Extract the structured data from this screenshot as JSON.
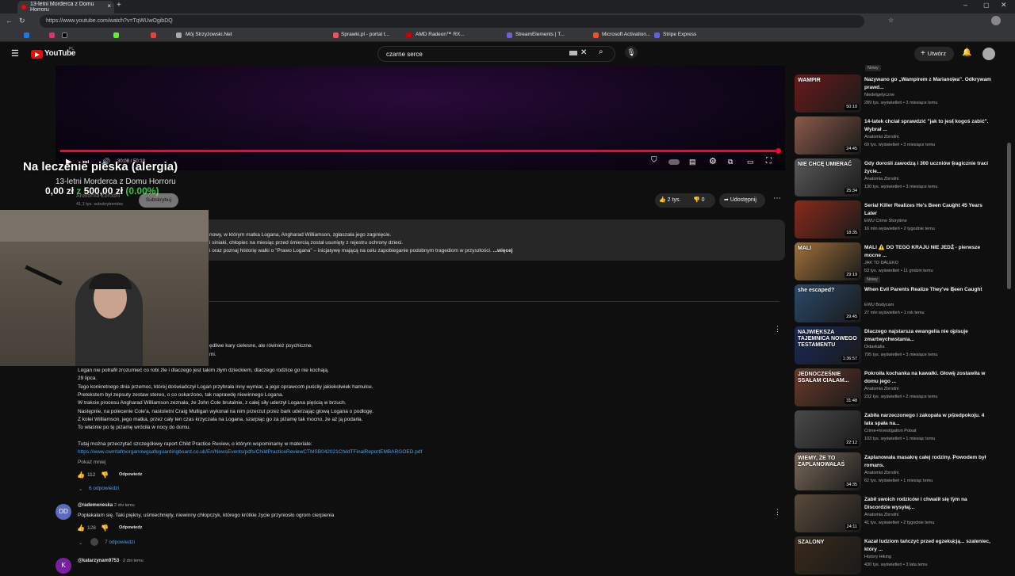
{
  "browser": {
    "tab_title": "13-letni Morderca z Domu Horroru",
    "url": "https://www.youtube.com/watch?v=TqWUwOgibDQ",
    "bookmarks": [
      "Mój Strzyżowski.Net",
      "Sprawki.pl - portal t...",
      "AMD Radeon™ RX...",
      "StreamElements | T...",
      "Microsoft Activation...",
      "Stripe Express"
    ]
  },
  "header": {
    "logo": "YouTube",
    "logo_region": "PL",
    "search_value": "czarne serce",
    "create_label": "Utwórz"
  },
  "player": {
    "time": "30:08 / 50:18",
    "progress": 0.996
  },
  "overlay": {
    "title": "Na leczenie pieska (alergia)",
    "subtitle": "13-letni Morderca z Domu Horroru",
    "money_prefix": "0,00 zł",
    "money_sep": " z ",
    "money_goal": "500,00 zł",
    "money_percent": "(0.00%)"
  },
  "channel": {
    "name": "Anatomia Zbrodni",
    "subscribers": "41,1 tys. subskrybentów",
    "subscribe": "Subskrybuj"
  },
  "actions": {
    "likes": "2 tys.",
    "dislikes": "0",
    "share": "Udostępnij"
  },
  "description": {
    "line1": "nowy, w którym matka Logana, Angharad Williamson, zgłaszała jego zaginięcie.",
    "line2": "i siniaki, chłopiec na miesiąc przed śmiercią został usunięty z rejestru ochrony dzieci.",
    "line3": "i oraz poznaj historię walki o \"Prawo Logana\" – inicjatywę mającą na celu zapobieganie podobnym tragediom w przyszłości.",
    "more": "...więcej"
  },
  "comment1": {
    "partial1": "ędliwe kary cielesne, ale również psychiczne.",
    "partial2": "mi.",
    "lines": [
      "Logan nie potrafił zrozumieć co robi źle i dlaczego jest takim złym dzieckiem, dlaczego rodzice go nie kochają.",
      "29 lipca.",
      "Tego konkretnego dnia przemoc, której doświadczył Logan przybrała inny wymiar, a jego oprawcom puściły jakiekolwiek hamulce.",
      "Pretekstem był zepsuty zestaw stereo, o co oskarżono, tak naprawdę niewinnego Logana.",
      "W trakcie procesu Angharad Williamson zeznała, że John Cole brutalnie, z całej siły uderzył Logana pięścią w brzuch.",
      "Następnie, na polecenie Cole'a, nastoletni Craig Mulligan wykonał na nim przerzut przez bark uderzając głową Logana o podłogę.",
      "Z kolei Williamson, jego matka, przez cały ten czas krzyczała na Logana, szarpiąc go za piżamę tak mocno, że aż ją podarła.",
      "To właśnie po tę piżamę wróciła w nocy do domu."
    ],
    "report_intro": "Tutaj można przeczytać szczegółowy raport Child Practice Review, o którym wspominamy w materiale:",
    "report_link": "https://www.cwmtafmorgannwgsafeguardingboard.co.uk/En/NewsEvents/pdfs/ChildPracticeReviewCTMSB042021ChildTFinalReportEMBARGOED.pdf",
    "show_less": "Pokaż mniej",
    "likes": "112",
    "reply": "Odpowiedz",
    "replies": "6 odpowiedzi"
  },
  "comment2": {
    "avatar": "DD",
    "author": "@rademeneska",
    "time": "2 dni temu",
    "text": "Popłakałam się. Taki piękny, uśmiechnięty, niewinny chłopczyk, którego krótkie życie przyniosło ogrom cierpienia",
    "likes": "128",
    "reply": "Odpowiedz",
    "replies": "7 odpowiedzi"
  },
  "comment3": {
    "avatar": "K",
    "author": "@katarzynam9753",
    "time": "2 dni temu"
  },
  "sidebar": [
    {
      "title": "Nazywano go „Wampirem z Marianowa\". Odkrywam prawd...",
      "channel": "Niedetgetyczne",
      "meta": "289 tys. wyświetleń • 3 miesiące temu",
      "duration": "50:10",
      "thumb_text": "WAMPIR",
      "color": "#6b1a1a"
    },
    {
      "title": "14-latek chciał sprawdzić \"jak to jest kogoś zabić\". Wybrał ...",
      "channel": "Anatomia Zbrodni",
      "meta": "69 tys. wyświetleń • 3 miesiące temu",
      "duration": "24:45",
      "thumb_text": "",
      "color": "#8b5a4a"
    },
    {
      "title": "Gdy dorośli zawodzą i 300 uczniów tragicznie traci życie...",
      "channel": "Anatomia Zbrodni",
      "meta": "130 tys. wyświetleń • 3 miesiące temu",
      "duration": "25:34",
      "thumb_text": "NIE CHCĘ UMIERAĆ",
      "color": "#5a5a5a"
    },
    {
      "title": "Serial Killer Realizes He's Been Caught 45 Years Later",
      "channel": "EWU Crime Storytime",
      "meta": "16 mln wyświetleń • 2 tygodnie temu",
      "duration": "18:35",
      "thumb_text": "",
      "color": "#8a2a1a"
    },
    {
      "title": "MALI ⚠️ DO TEGO KRAJU NIE JEDŹ - pierwsze mocne ...",
      "channel": "JAK TO DALEKO",
      "meta": "53 tys. wyświetleń • 11 godzin temu",
      "duration": "29:19",
      "thumb_text": "MALI",
      "color": "#a0703a",
      "badge": "Nowy"
    },
    {
      "title": "When Evil Parents Realize They've Been Caught",
      "channel": "EWU Bodycam",
      "meta": "27 mln wyświetleń • 1 rok temu",
      "duration": "29:45",
      "thumb_text": "she escaped?",
      "color": "#2a4a6a"
    },
    {
      "title": "Dlaczego najstarsza ewangelia nie opisuje zmartwychwstania...",
      "channel": "Didaskalia",
      "meta": "795 tys. wyświetleń • 3 miesiące temu",
      "duration": "1:36:57",
      "thumb_text": "NAJWIĘKSZA TAJEMNICA NOWEGO TESTAMENTU",
      "color": "#1a2a5a"
    },
    {
      "title": "Pokroiła kochanka na kawałki. Głowę zostawiła w domu jego ...",
      "channel": "Anatomia Zbrodni",
      "meta": "232 tys. wyświetleń • 2 miesiące temu",
      "duration": "31:48",
      "thumb_text": "JEDNOCZEŚNIE SSAŁAM CIAŁAM...",
      "color": "#6a3a2a"
    },
    {
      "title": "Zabiła narzeczonego i zakopała w przedpokoju. 4 lata spała na...",
      "channel": "Crime+Investigation Polsat",
      "meta": "103 tys. wyświetleń • 1 miesiąc temu",
      "duration": "22:12",
      "thumb_text": "",
      "color": "#4a4a4a"
    },
    {
      "title": "Zaplanowała masakrę całej rodziny. Powodem był romans.",
      "channel": "Anatomia Zbrodni",
      "meta": "62 tys. wyświetleń • 1 miesiąc temu",
      "duration": "34:35",
      "thumb_text": "WIEMY, ŻE TO ZAPLANOWAŁAŚ",
      "color": "#7a6a5a"
    },
    {
      "title": "Zabił swoich rodziców i chwalił się tym na Discordzie wysyłaj...",
      "channel": "Anatomia Zbrodni",
      "meta": "41 tys. wyświetleń • 2 tygodnie temu",
      "duration": "24:11",
      "thumb_text": "",
      "color": "#5a4a3a"
    },
    {
      "title": "Kazał ludziom tańczyć przed egzekucją... szaleniec, który ...",
      "channel": "History Hiking",
      "meta": "430 tys. wyświetleń • 3 lata temu",
      "duration": "",
      "thumb_text": "SZALONY",
      "color": "#3a2a1a"
    }
  ],
  "sidebar_top_badge": "Nowy",
  "colors": {
    "accent": "#ff0000",
    "link": "#3ea6ff",
    "money_green": "#2ecc40"
  }
}
